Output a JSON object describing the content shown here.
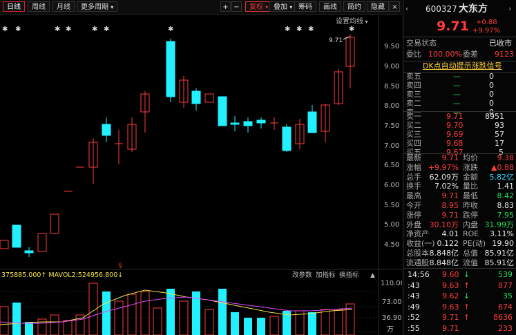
{
  "toolbar": {
    "periods": [
      "日线",
      "周线",
      "月线",
      "更多周期"
    ],
    "zoom_in": "+",
    "zoom_out": "−",
    "adjust": "复权",
    "overlay": "叠加",
    "chips": "筹码",
    "draw": "画线",
    "simple": "简约",
    "hide": "隐藏",
    "set_ma": "设置均线"
  },
  "chart": {
    "price_ticks": [
      "9.50",
      "9.00",
      "8.50",
      "8.00",
      "7.50",
      "7.00",
      "6.50",
      "6.00",
      "5.50",
      "5.00",
      "4.50"
    ],
    "last_price_label": "9.71",
    "volume_ticks": [
      "110.00",
      "73.00",
      "36.90",
      "万"
    ],
    "volume_header": "375885.000↑  MAVOL2:524956.800↓",
    "vol_buttons": [
      "改参数",
      "加指标",
      "换指标"
    ]
  },
  "quote": {
    "code": "600327",
    "name": "大东方",
    "price": "9.71",
    "change": "+0.88",
    "change_pct": "+9.97%",
    "status_label": "交易状态",
    "status_value": "已收市",
    "weibi_label": "委比",
    "weibi_value": "100.00%",
    "weicha_label": "委差",
    "weicha_value": "9123",
    "signal": "DK点自动提示涨跌信号",
    "asks": [
      {
        "label": "卖五",
        "price": "—",
        "vol": "0"
      },
      {
        "label": "卖四",
        "price": "—",
        "vol": "0"
      },
      {
        "label": "卖三",
        "price": "—",
        "vol": "0"
      },
      {
        "label": "卖二",
        "price": "—",
        "vol": "0"
      },
      {
        "label": "卖一",
        "price": "—",
        "vol": "0"
      }
    ],
    "bids": [
      {
        "label": "买一",
        "price": "9.71",
        "vol": "8951"
      },
      {
        "label": "买二",
        "price": "9.70",
        "vol": "93"
      },
      {
        "label": "买三",
        "price": "9.69",
        "vol": "57"
      },
      {
        "label": "买四",
        "price": "9.68",
        "vol": "17"
      },
      {
        "label": "买五",
        "price": "9.67",
        "vol": "5"
      }
    ],
    "stats": [
      [
        "最新",
        "9.71",
        "均价",
        "9.38"
      ],
      [
        "涨幅",
        "+9.97%",
        "涨跌",
        "▲0.88"
      ],
      [
        "总手",
        "62.09万",
        "金额",
        "5.82亿"
      ],
      [
        "换手",
        "7.02%",
        "量比",
        "1.41"
      ],
      [
        "最高",
        "9.71",
        "最低",
        "8.42"
      ],
      [
        "今开",
        "8.95",
        "昨收",
        "8.83"
      ],
      [
        "涨停",
        "9.71",
        "跌停",
        "7.95"
      ],
      [
        "外盘",
        "30.10万",
        "内盘",
        "31.99万"
      ],
      [
        "净资产",
        "4.01",
        "ROE",
        "3.11%"
      ],
      [
        "收益(一)",
        "0.122",
        "PE(动)",
        "19.90"
      ],
      [
        "总股本",
        "8.848亿",
        "总值",
        "85.91亿"
      ],
      [
        "流通股",
        "8.848亿",
        "流值",
        "85.91亿"
      ]
    ],
    "ticks": [
      {
        "time": "14:56",
        "price": "9.60",
        "arrow": "↓",
        "vol": "539"
      },
      {
        "time": ":43",
        "price": "9.63",
        "arrow": "↑",
        "vol": "877"
      },
      {
        "time": ":43",
        "price": "9.62",
        "arrow": "↓",
        "vol": "35"
      },
      {
        "time": ":49",
        "price": "9.63",
        "arrow": "↑",
        "vol": "674"
      },
      {
        "time": ":52",
        "price": "9.71",
        "arrow": "↑",
        "vol": "8636"
      },
      {
        "time": ":55",
        "price": "9.71",
        "arrow": "",
        "vol": "233"
      }
    ]
  },
  "colors": {
    "up": "#ff3c3c",
    "down": "#20f0ff",
    "ma1": "#f2e34c",
    "ma2": "#e24cff"
  }
}
